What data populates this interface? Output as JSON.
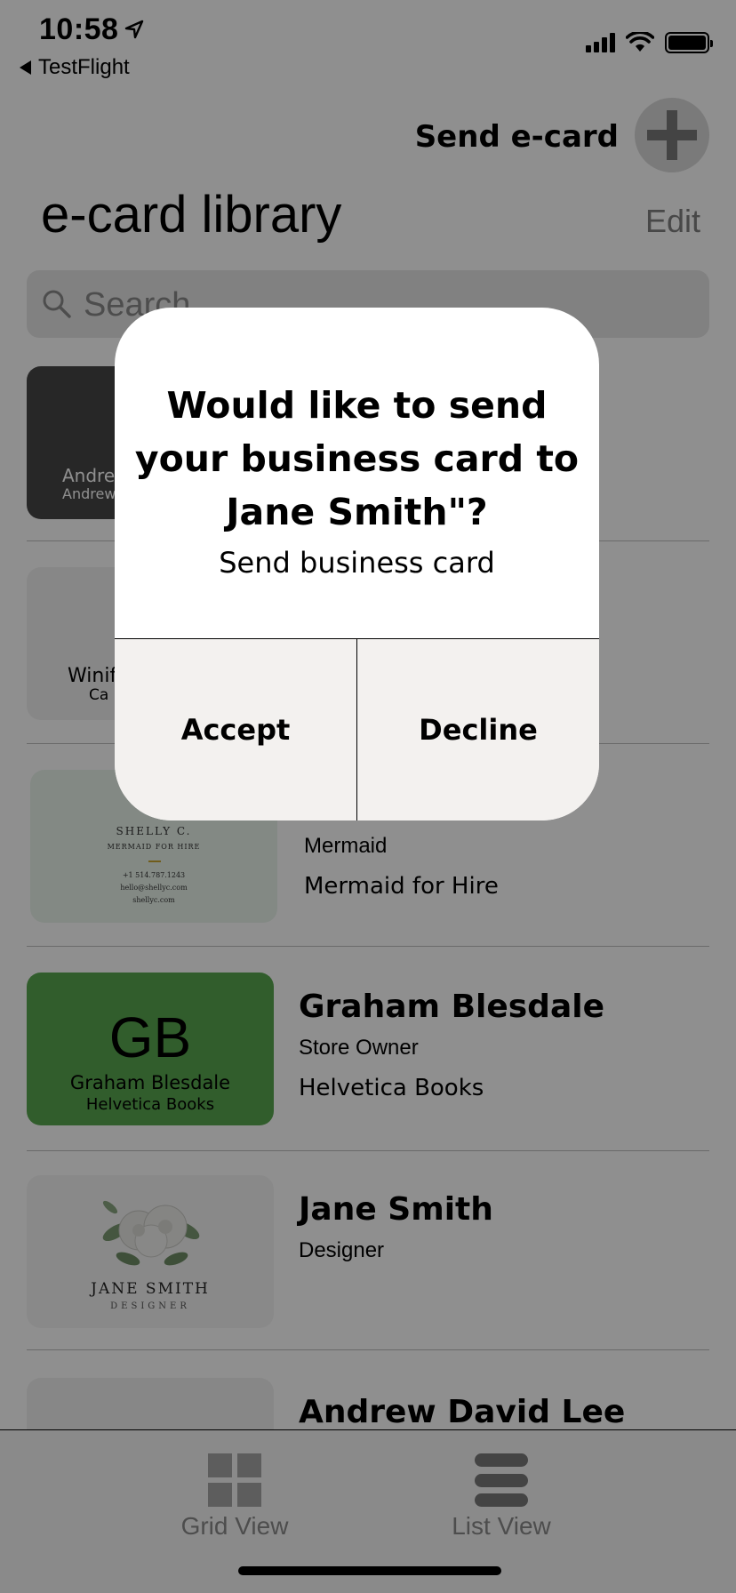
{
  "status_bar": {
    "time": "10:58",
    "back_label": "TestFlight"
  },
  "header": {
    "send_label": "Send e-card",
    "title": "e-card library",
    "edit_label": "Edit"
  },
  "search": {
    "placeholder": "Search"
  },
  "cards": [
    {
      "card_lines": [
        "Andre",
        "Andrew"
      ]
    },
    {
      "card_lines": [
        "Winif",
        "Ca"
      ]
    },
    {
      "card_lines": [
        "SHELLY C.",
        "MERMAID FOR HIRE",
        "+1 514.787.1243",
        "hello@shellyc.com",
        "shellyc.com"
      ],
      "role": "Mermaid",
      "company": "Mermaid for Hire"
    },
    {
      "card_lines": [
        "GB",
        "Graham Blesdale",
        "Helvetica Books"
      ],
      "name": "Graham Blesdale",
      "role": "Store Owner",
      "company": "Helvetica Books"
    },
    {
      "card_lines": [
        "JANE SMITH",
        "DESIGNER"
      ],
      "name": "Jane Smith",
      "role": "Designer"
    },
    {
      "name": "Andrew David Lee"
    }
  ],
  "tabs": [
    {
      "label": "Grid View"
    },
    {
      "label": "List View"
    }
  ],
  "dialog": {
    "title": "Would like to send your business card to Jane Smith\"?",
    "message": "Send business card",
    "accept_label": "Accept",
    "decline_label": "Decline"
  },
  "colors": {
    "green_card": "#58a74f",
    "dark_card": "#474747",
    "overlay": "rgba(0,0,0,0.44)"
  }
}
